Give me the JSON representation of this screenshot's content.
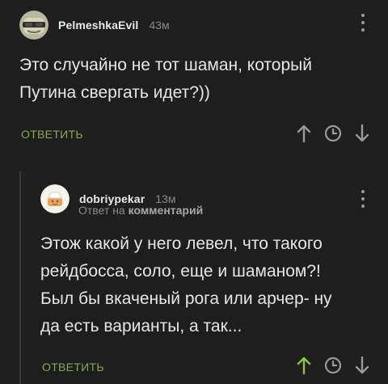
{
  "comments": [
    {
      "author": "PelmeshkaEvil",
      "time": "43м",
      "text": "Это случайно не тот шаман, который\nПутина свергать идет?))",
      "reply_label": "ОТВЕТИТЬ",
      "avatar_icon": "avatar-image",
      "upvote_active": false
    },
    {
      "author": "dobriypekar",
      "time": "13м",
      "reply_to_prefix": "Ответ на",
      "reply_to_target": "комментарий",
      "text": "Этож какой у него левел, что такого\nрейдбосса, соло, еще и шаманом?!\nБыл бы вкаченый рога или арчер- ну\nда есть варианты, а так...",
      "reply_label": "ОТВЕТИТЬ",
      "avatar_icon": "avatar-image",
      "upvote_active": true
    }
  ],
  "colors": {
    "background": "#1e1e1e",
    "accent_green": "#8aa653",
    "upvote_active": "#8ac44a",
    "icon_gray": "#9a9a9a"
  }
}
